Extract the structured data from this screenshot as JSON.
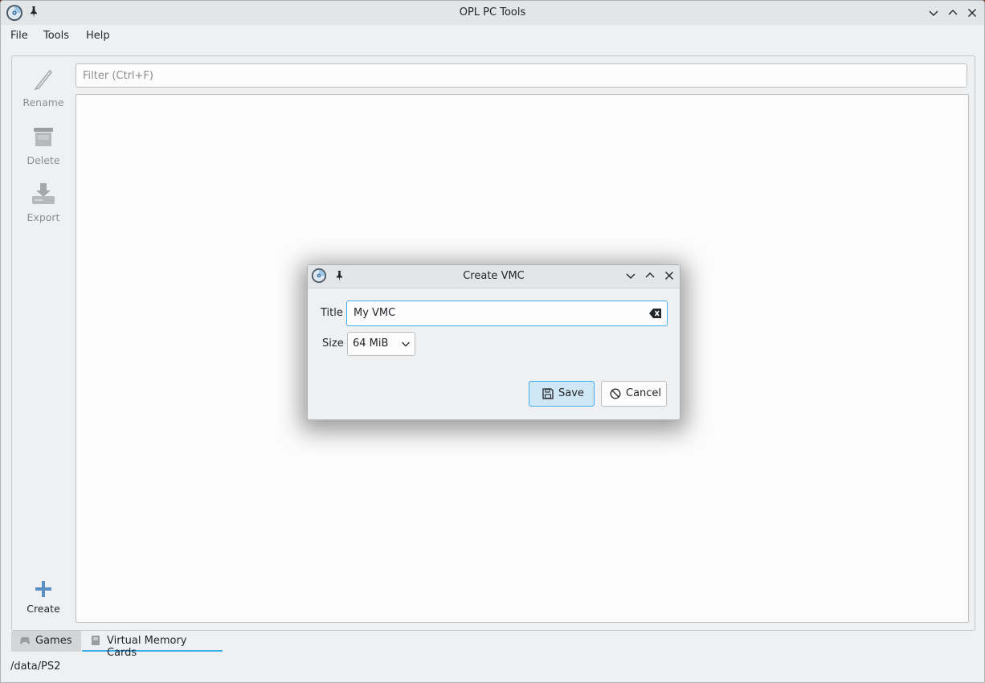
{
  "window": {
    "title": "OPL PC Tools"
  },
  "menu": {
    "file": "File",
    "tools": "Tools",
    "help": "Help"
  },
  "toolbar": {
    "rename": "Rename",
    "delete": "Delete",
    "export": "Export",
    "create": "Create"
  },
  "filter": {
    "placeholder": "Filter (Ctrl+F)"
  },
  "tabs": {
    "games": "Games",
    "vmc": "Virtual Memory Cards"
  },
  "status": {
    "path": "/data/PS2"
  },
  "dialog": {
    "title": "Create VMC",
    "title_label": "Title",
    "title_value": "My VMC",
    "size_label": "Size",
    "size_value": "64 MiB",
    "save_label": "Save",
    "cancel_label": "Cancel"
  },
  "colors": {
    "accent": "#3daee9",
    "window_bg": "#eff0f1",
    "save_bg": "#cfe6f5"
  }
}
